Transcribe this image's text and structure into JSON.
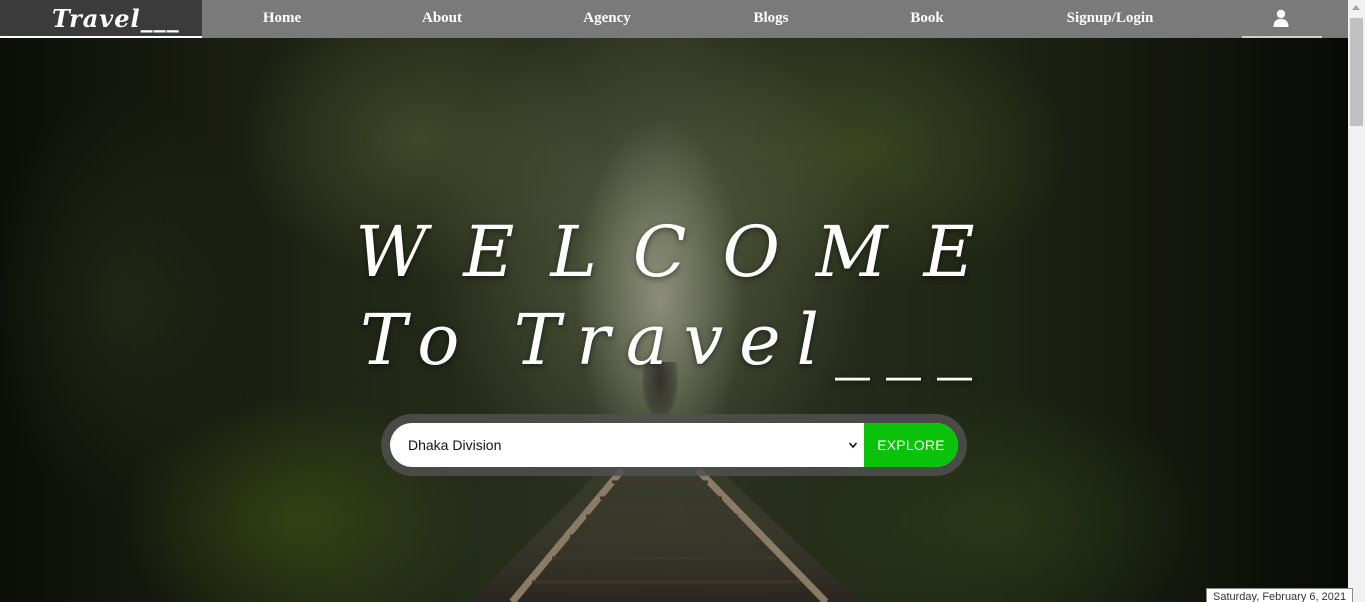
{
  "nav": {
    "brand": "Travel___",
    "links": [
      "Home",
      "About",
      "Agency",
      "Blogs",
      "Book",
      "Signup/Login"
    ],
    "user_icon": "user-icon"
  },
  "hero": {
    "headline": "WELCOME",
    "subtitle": "To Travel___"
  },
  "search": {
    "selected": "Dhaka Division",
    "button": "EXPLORE"
  },
  "status": {
    "date": "Saturday, February 6, 2021"
  },
  "colors": {
    "nav_bg": "#7a7a7a",
    "brand_bg": "#3b3b3b",
    "explore_button": "#0ac20a"
  }
}
